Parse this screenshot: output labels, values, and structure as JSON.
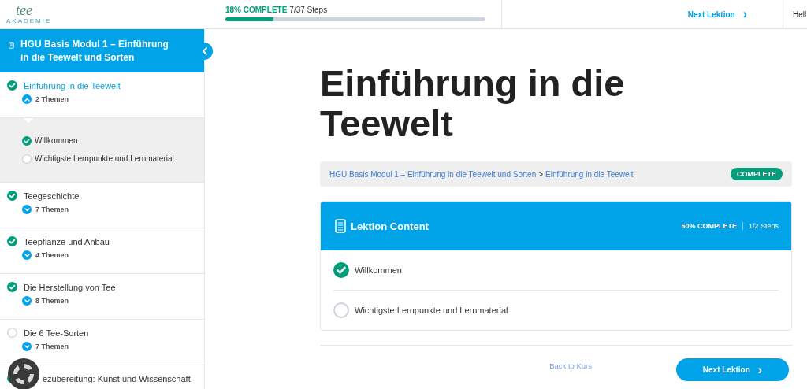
{
  "logo": {
    "script": "tee",
    "sub": "AKADEMIE"
  },
  "progress": {
    "percent": "18% COMPLETE",
    "steps": "7/37 Steps",
    "level": 0.185
  },
  "header_next": {
    "label": "Next Lektion",
    "icon": "›"
  },
  "header_user": "Hell",
  "sidebar": {
    "title": "HGU Basis Modul 1 – Einführung in die Teewelt und Sorten",
    "items": [
      {
        "title": "Einführung in die Teewelt",
        "count": "2 Themen",
        "completed": true,
        "selected": true,
        "expanded": true,
        "children": [
          {
            "title": "Willkommen",
            "completed": true
          },
          {
            "title": "Wichtigste Lernpunkte und Lernmaterial",
            "completed": false
          }
        ]
      },
      {
        "title": "Teegeschichte",
        "count": "7 Themen",
        "completed": true,
        "selected": false,
        "expanded": false
      },
      {
        "title": "Teepflanze und Anbau",
        "count": "4 Themen",
        "completed": true,
        "selected": false,
        "expanded": false
      },
      {
        "title": "Die Herstellung von Tee",
        "count": "8 Themen",
        "completed": true,
        "selected": false,
        "expanded": false
      },
      {
        "title": "Die 6 Tee-Sorten",
        "count": "7 Themen",
        "completed": false,
        "selected": false,
        "expanded": false
      },
      {
        "title": "ezubereitung: Kunst und Wissenschaft",
        "completed": true,
        "selected": false
      }
    ]
  },
  "page_title": "Einführung in die Teewelt",
  "breadcrumb": {
    "parent": "HGU Basis Modul 1 – Einführung in die Teewelt und Sorten",
    "separator": ">",
    "current": "Einführung in die Teewelt",
    "status": "COMPLETE"
  },
  "lesson_content": {
    "title": "Lektion Content",
    "percent": "50% COMPLETE",
    "steps": "1/2 Steps",
    "topics": [
      {
        "title": "Willkommen",
        "completed": true
      },
      {
        "title": "Wichtigste Lernpunkte und Lernmaterial",
        "completed": false
      }
    ]
  },
  "footer": {
    "back": "Back to Kurs",
    "next": "Next Lektion",
    "next_icon": "›"
  }
}
